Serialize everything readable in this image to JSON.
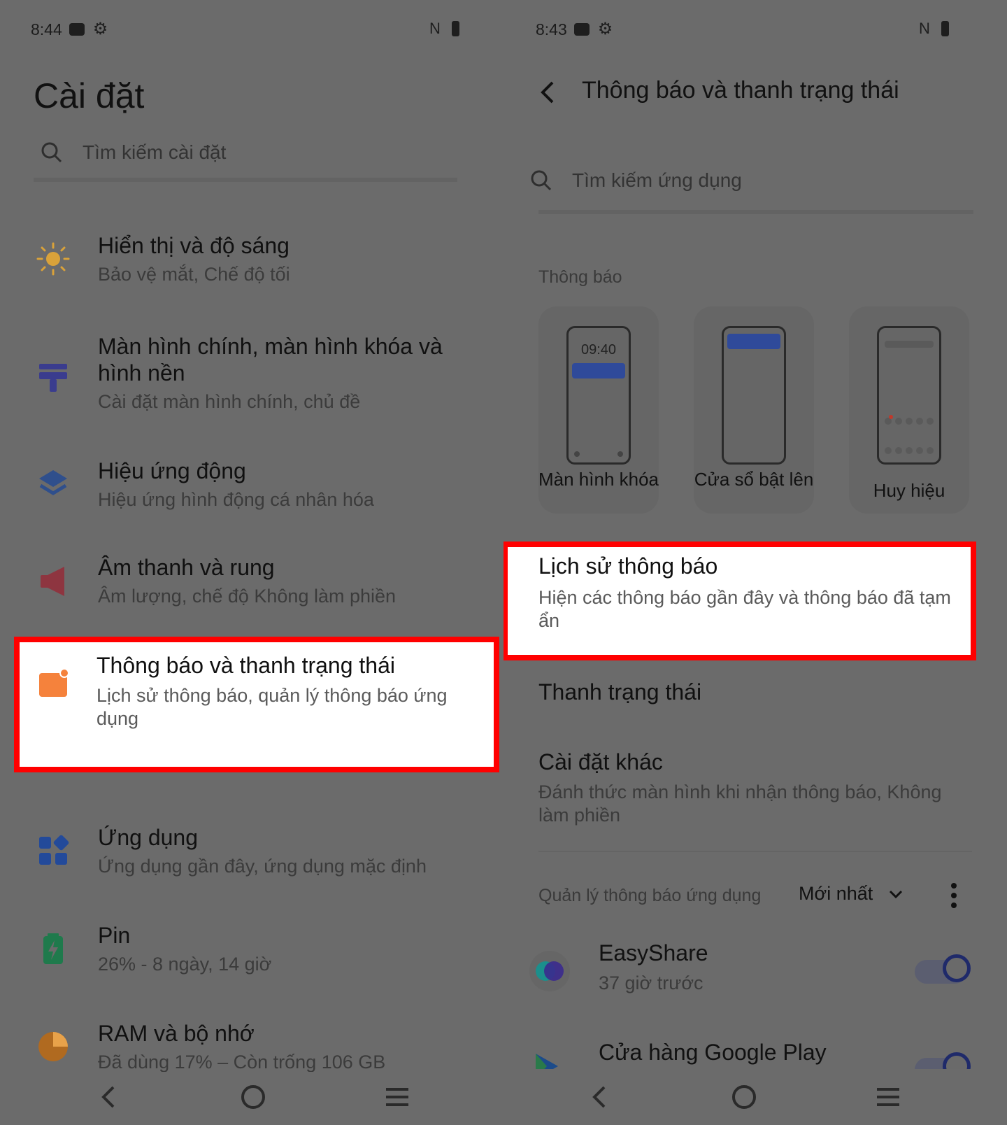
{
  "left": {
    "status_time": "8:44",
    "title": "Cài đặt",
    "search_placeholder": "Tìm kiếm cài đặt",
    "items": [
      {
        "title": "Hiển thị và độ sáng",
        "subtitle": "Bảo vệ mắt, Chế độ tối",
        "icon": "sun-icon",
        "color": "#d9a23a"
      },
      {
        "title": "Màn hình chính, màn hình khóa và hình nền",
        "subtitle": "Cài đặt màn hình chính, chủ đề",
        "icon": "wallpaper-icon",
        "color": "#3a3c8e"
      },
      {
        "title": "Hiệu ứng động",
        "subtitle": "Hiệu ứng hình động cá nhân hóa",
        "icon": "layers-icon",
        "color": "#2f4f8c"
      },
      {
        "title": "Âm thanh và rung",
        "subtitle": "Âm lượng, chế độ Không làm phiền",
        "icon": "speaker-icon",
        "color": "#8e3540"
      },
      {
        "title": "Thông báo và thanh trạng thái",
        "subtitle": "Lịch sử thông báo, quản lý thông báo ứng dụng",
        "icon": "notification-icon",
        "color": "#f5823c"
      },
      {
        "title": "Ứng dụng",
        "subtitle": "Ứng dụng gần đây, ứng dụng mặc định",
        "icon": "apps-icon",
        "color": "#234a9a"
      },
      {
        "title": "Pin",
        "subtitle": "26% - 8 ngày, 14 giờ",
        "icon": "battery-icon",
        "color": "#1f7a4c"
      },
      {
        "title": "RAM và bộ nhớ",
        "subtitle": "Đã dùng 17% – Còn trống 106 GB",
        "icon": "storage-pie-icon",
        "color": "#b06a20"
      }
    ]
  },
  "right": {
    "status_time": "8:43",
    "title": "Thông báo và thanh trạng thái",
    "search_placeholder": "Tìm kiếm ứng dụng",
    "section_notifications": "Thông báo",
    "cards": [
      {
        "label": "Màn hình khóa",
        "clock": "09:40"
      },
      {
        "label": "Cửa sổ bật lên"
      },
      {
        "label": "Huy hiệu"
      }
    ],
    "history_title": "Lịch sử thông báo",
    "history_sub": "Hiện các thông báo gần đây và thông báo đã tạm ẩn",
    "status_bar_title": "Thanh trạng thái",
    "other_title": "Cài đặt khác",
    "other_sub": "Đánh thức màn hình khi nhận thông báo, Không làm phiền",
    "manage_label": "Quản lý thông báo ứng dụng",
    "sort_label": "Mới nhất",
    "apps": [
      {
        "name": "EasyShare",
        "time": "37 giờ trước"
      },
      {
        "name": "Cửa hàng Google Play",
        "time": ""
      }
    ]
  }
}
